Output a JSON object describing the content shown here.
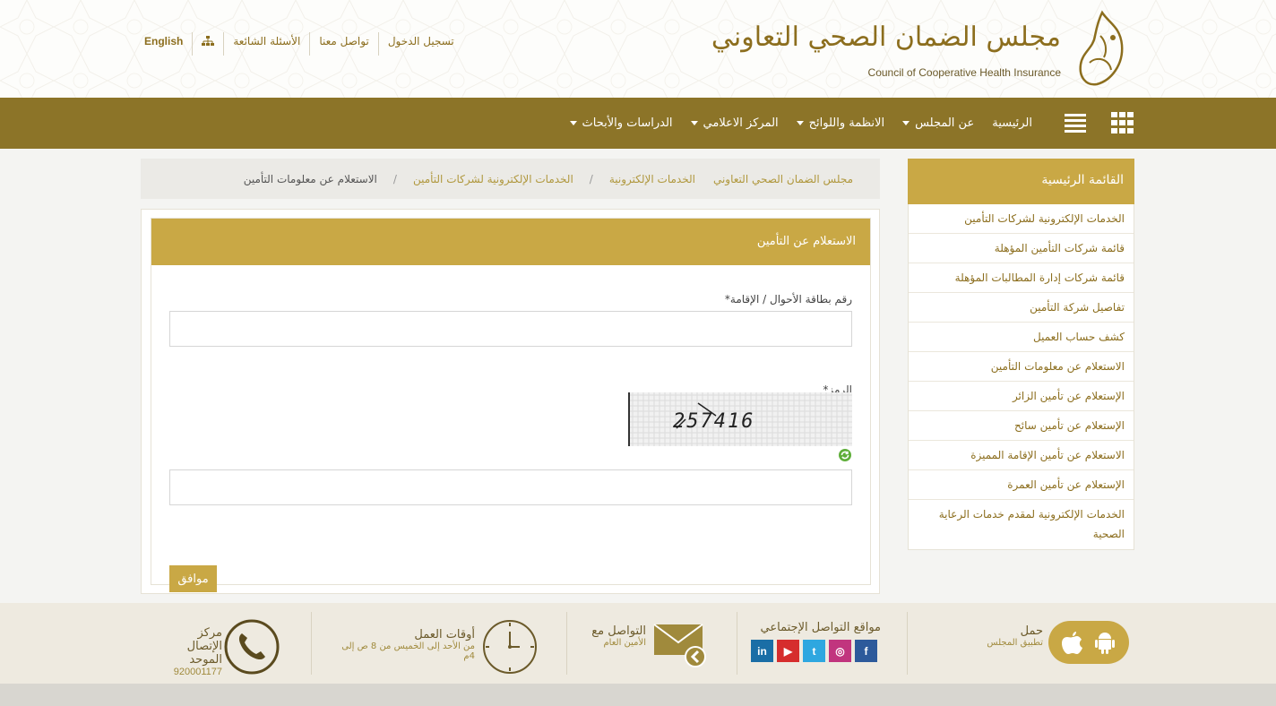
{
  "header": {
    "logo_arabic": "مجلس الضمان الصحي التعاوني",
    "logo_english": "Council of Cooperative Health Insurance",
    "top_links": {
      "login": "تسجيل الدخول",
      "contact": "تواصل معنا",
      "faq": "الأسئلة الشائعة",
      "sitemap_icon": "sitemap-icon",
      "language": "English"
    }
  },
  "nav": {
    "items": [
      {
        "label": "الرئيسية",
        "dropdown": false
      },
      {
        "label": "عن المجلس",
        "dropdown": true
      },
      {
        "label": "الانظمة واللوائح",
        "dropdown": true
      },
      {
        "label": "المركز الاعلامي",
        "dropdown": true
      },
      {
        "label": "الدراسات والأبحاث",
        "dropdown": true
      }
    ],
    "icons": [
      "grid-icon",
      "list-icon"
    ],
    "background": "#8c7428"
  },
  "breadcrumb": {
    "items": [
      "مجلس الضمان الصحي التعاوني",
      "الخدمات الإلكترونية",
      "الخدمات الإلكترونية لشركات التأمين"
    ],
    "separator": "/",
    "current": "الاستعلام عن معلومات التأمين"
  },
  "sidebar": {
    "title": "القائمة الرئيسية",
    "items": [
      "الخدمات الإلكترونية لشركات التأمين",
      "قائمة شركات التأمين المؤهلة",
      "قائمة شركات إدارة المطالبات المؤهلة",
      "تفاصيل شركة التأمين",
      "كشف حساب العميل",
      "الاستعلام عن معلومات التأمين",
      "الإستعلام عن تأمين الزائر",
      "الإستعلام عن تأمين سائح",
      "الاستعلام عن تأمين الإقامة المميزة",
      "الإستعلام عن تأمين العمرة",
      "الخدمات الإلكترونية لمقدم خدمات الرعاية الصحية"
    ]
  },
  "form": {
    "title": "الاستعلام عن التأمين",
    "id_label": "رقم بطاقة الأحوال / الإقامة*",
    "id_value": "",
    "captcha_label": "الرمز*",
    "captcha_text": "257416",
    "captcha_value": "",
    "submit_label": "موافق"
  },
  "footer": {
    "app": {
      "title": "حمل",
      "subtitle": "تطبيق المجلس"
    },
    "social": {
      "title": "مواقع التواصل الإجتماعي",
      "networks": [
        "facebook",
        "instagram",
        "twitter",
        "youtube",
        "linkedin"
      ]
    },
    "contact": {
      "title": "التواصل مع",
      "subtitle": "الأمين العام"
    },
    "hours": {
      "title": "أوقات العمل",
      "subtitle": "من الأحد إلى الخميس من 8 ص إلى 4م"
    },
    "call": {
      "title_line1": "مركز الإتصال",
      "title_line2": "الموحد",
      "number": "920001177"
    }
  },
  "colors": {
    "accent": "#c9a845",
    "brand_dark": "#8c7428",
    "facebook": "#2d5a9b",
    "instagram": "#c1357e",
    "twitter": "#2ea7e0",
    "youtube": "#d62d2d",
    "linkedin": "#1a6ea6"
  }
}
